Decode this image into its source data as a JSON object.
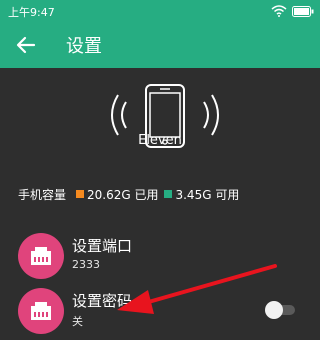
{
  "status_bar": {
    "time": "上午9:47",
    "icons": [
      "wifi-icon",
      "battery-icon"
    ]
  },
  "toolbar": {
    "title": "设置",
    "back_icon": "back-arrow-icon"
  },
  "device": {
    "name": "Eleven",
    "icon": "phone-vibrate-icon"
  },
  "storage": {
    "label": "手机容量",
    "used": "20.62G 已用",
    "free": "3.45G 可用",
    "used_color": "#f58a1f",
    "free_color": "#26ad82"
  },
  "settings": {
    "port": {
      "label": "设置端口",
      "value": "2333",
      "icon": "ethernet-port-icon"
    },
    "password": {
      "label": "设置密码",
      "value": "关",
      "icon": "ethernet-port-icon",
      "enabled": false
    }
  },
  "colors": {
    "accent": "#26ad82",
    "avatar": "#e0447c",
    "annotation_arrow": "#e8141e"
  }
}
